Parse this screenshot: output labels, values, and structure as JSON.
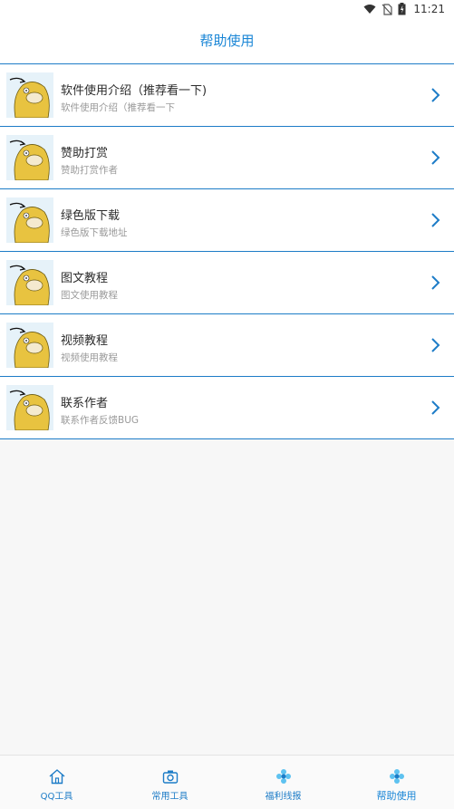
{
  "status_bar": {
    "time": "11:21"
  },
  "header": {
    "title": "帮助使用"
  },
  "items": [
    {
      "title": "软件使用介绍（推荐看一下)",
      "subtitle": "软件使用介绍（推荐看一下"
    },
    {
      "title": "赞助打赏",
      "subtitle": "赞助打赏作者"
    },
    {
      "title": "绿色版下载",
      "subtitle": "绿色版下载地址"
    },
    {
      "title": "图文教程",
      "subtitle": "图文使用教程"
    },
    {
      "title": "视频教程",
      "subtitle": "视频使用教程"
    },
    {
      "title": "联系作者",
      "subtitle": "联系作者反馈BUG"
    }
  ],
  "tabs": [
    {
      "label": "QQ工具",
      "icon": "home-icon"
    },
    {
      "label": "常用工具",
      "icon": "camera-icon"
    },
    {
      "label": "福利线报",
      "icon": "flower-icon"
    },
    {
      "label": "帮助使用",
      "icon": "flower-icon"
    }
  ],
  "colors": {
    "accent": "#1a86d6",
    "divider": "#1d7cc7",
    "avatar_yellow": "#e8c340"
  }
}
